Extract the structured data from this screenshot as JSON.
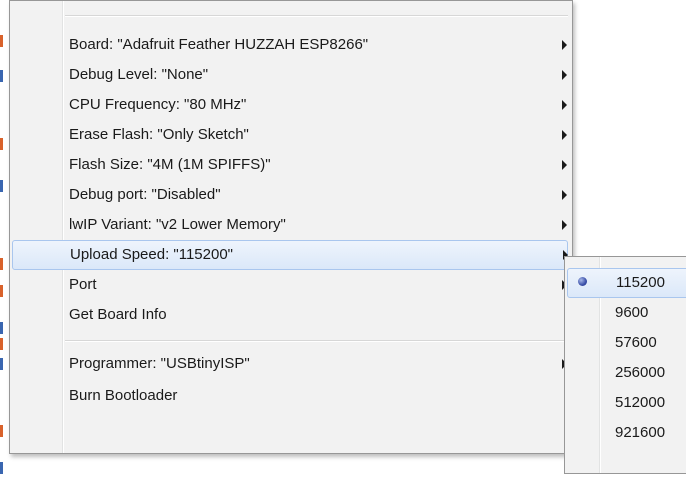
{
  "menu": {
    "items": [
      {
        "label": "Board: \"Adafruit Feather HUZZAH ESP8266\"",
        "has_submenu": true
      },
      {
        "label": "Debug Level: \"None\"",
        "has_submenu": true
      },
      {
        "label": "CPU Frequency: \"80 MHz\"",
        "has_submenu": true
      },
      {
        "label": "Erase Flash: \"Only Sketch\"",
        "has_submenu": true
      },
      {
        "label": "Flash Size: \"4M (1M SPIFFS)\"",
        "has_submenu": true
      },
      {
        "label": "Debug port: \"Disabled\"",
        "has_submenu": true
      },
      {
        "label": "lwIP Variant: \"v2 Lower Memory\"",
        "has_submenu": true
      },
      {
        "label": "Upload Speed: \"115200\"",
        "has_submenu": true,
        "highlighted": true
      },
      {
        "label": "Port",
        "has_submenu": true
      },
      {
        "label": "Get Board Info",
        "has_submenu": false
      },
      {
        "label": "Programmer: \"USBtinyISP\"",
        "has_submenu": true
      },
      {
        "label": "Burn Bootloader",
        "has_submenu": false
      }
    ]
  },
  "submenu": {
    "selected": "115200",
    "items": [
      {
        "label": "115200"
      },
      {
        "label": "9600"
      },
      {
        "label": "57600"
      },
      {
        "label": "256000"
      },
      {
        "label": "512000"
      },
      {
        "label": "921600"
      }
    ]
  },
  "colors": {
    "menu_bg": "#f2f2f2",
    "highlight_border": "#a9c6ee",
    "radio": "#3a4fa8"
  }
}
